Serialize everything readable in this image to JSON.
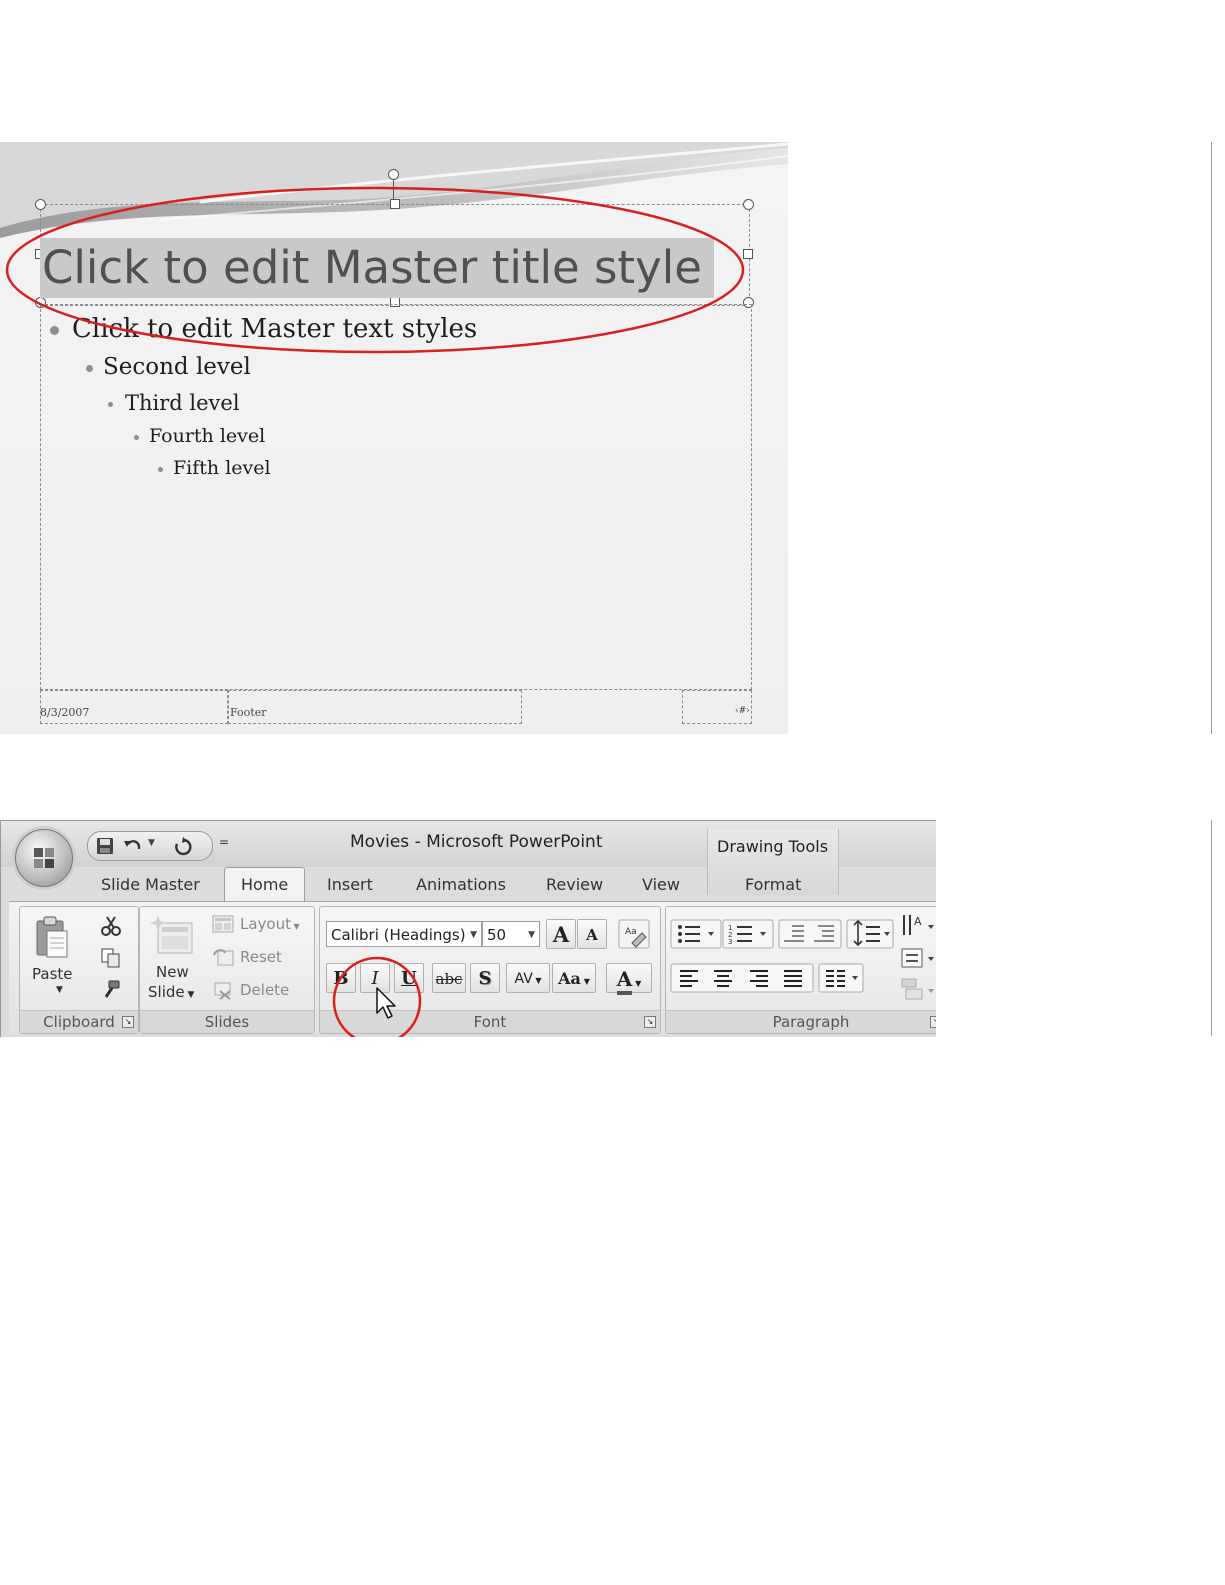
{
  "slide": {
    "title": "Click to edit Master title style",
    "levels": [
      "Click to edit Master text styles",
      "Second level",
      "Third level",
      "Fourth level",
      "Fifth level"
    ],
    "date": "8/3/2007",
    "footer": "Footer",
    "slide_number": "‹#›",
    "highlight_color": "#d92020"
  },
  "ribbon": {
    "window_title": "Movies - Microsoft PowerPoint",
    "context_title": "Drawing Tools",
    "qat": {
      "icons": [
        "save-icon",
        "undo-icon",
        "redo-icon"
      ],
      "more": "="
    },
    "tabs": [
      "Slide Master",
      "Home",
      "Insert",
      "Animations",
      "Review",
      "View",
      "Format"
    ],
    "active_tab": "Home",
    "groups": {
      "clipboard": {
        "label": "Clipboard",
        "paste_label": "Paste"
      },
      "slides": {
        "label": "Slides",
        "new_slide_line1": "New",
        "new_slide_line2": "Slide",
        "layout": "Layout",
        "reset": "Reset",
        "delete": "Delete"
      },
      "font": {
        "label": "Font",
        "font_name": "Calibri (Headings)",
        "font_size": "50",
        "grow": "A",
        "shrink": "A",
        "bold": "B",
        "italic": "I",
        "underline": "U",
        "strike": "abc",
        "shadow": "S",
        "spacing": "AV",
        "case": "Aa",
        "color": "A"
      },
      "paragraph": {
        "label": "Paragraph"
      }
    }
  }
}
